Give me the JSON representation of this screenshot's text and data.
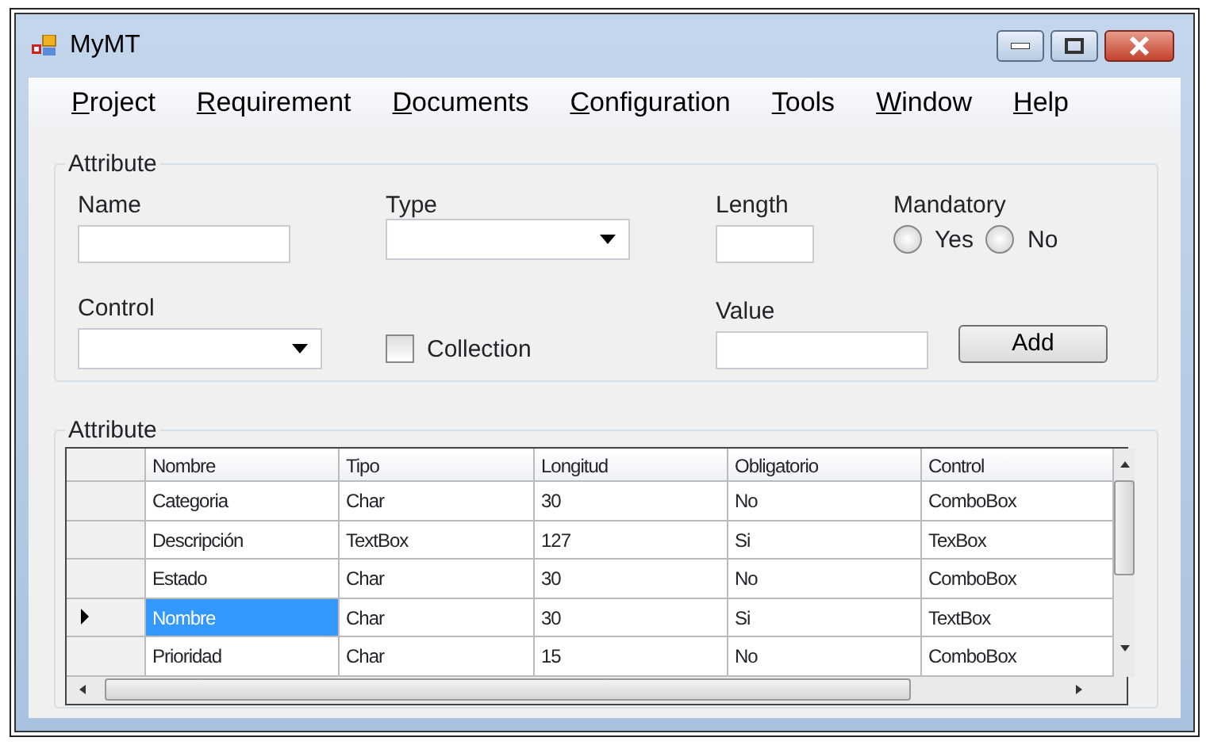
{
  "window": {
    "title": "MyMT"
  },
  "menu": [
    "Project",
    "Requirement",
    "Documents",
    "Configuration",
    "Tools",
    "Window",
    "Help"
  ],
  "form": {
    "legend": "Attribute",
    "name_label": "Name",
    "type_label": "Type",
    "length_label": "Length",
    "mandatory_label": "Mandatory",
    "mandatory_options": [
      {
        "label": "Yes",
        "selected": false
      },
      {
        "label": "No",
        "selected": false
      }
    ],
    "control_label": "Control",
    "collection": {
      "label": "Collection",
      "checked": false
    },
    "value_label": "Value",
    "add_button": "Add"
  },
  "grid": {
    "legend": "Attribute",
    "columns": [
      "Nombre",
      "Tipo",
      "Longitud",
      "Obligatorio",
      "Control"
    ],
    "rows": [
      {
        "cells": [
          "Categoria",
          "Char",
          "30",
          "No",
          "ComboBox"
        ],
        "selected": false
      },
      {
        "cells": [
          "Descripción",
          "TextBox",
          "127",
          "Si",
          "TexBox"
        ],
        "selected": false
      },
      {
        "cells": [
          "Estado",
          "Char",
          "30",
          "No",
          "ComboBox"
        ],
        "selected": false
      },
      {
        "cells": [
          "Nombre",
          "Char",
          "30",
          "Si",
          "TextBox"
        ],
        "selected": true
      },
      {
        "cells": [
          "Prioridad",
          "Char",
          "15",
          "No",
          "ComboBox"
        ],
        "selected": false
      }
    ]
  }
}
